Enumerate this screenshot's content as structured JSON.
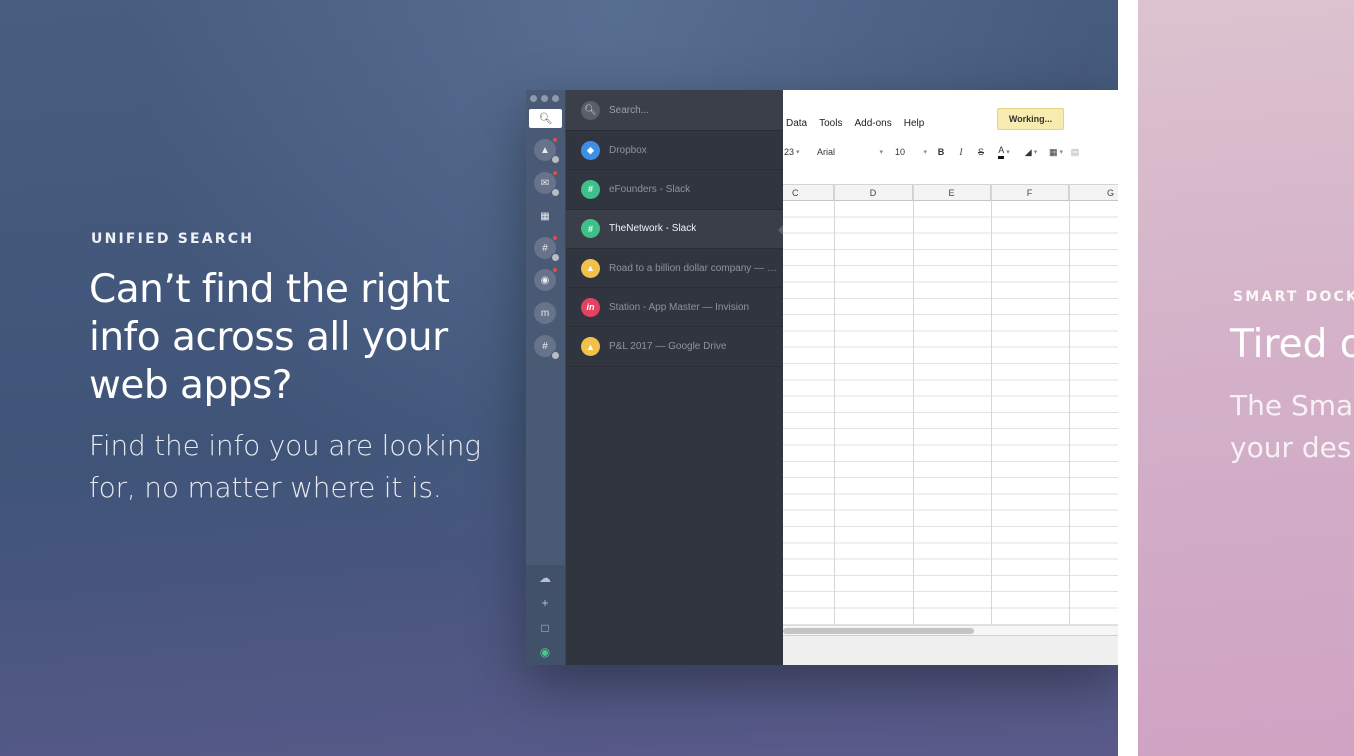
{
  "slide": {
    "eyebrow": "UNIFIED SEARCH",
    "headline": "Can’t find the right info across all your web apps?",
    "subline": "Find the info you are looking for, no matter where it is."
  },
  "search": {
    "placeholder": "Search..."
  },
  "results": [
    {
      "label": "Dropbox",
      "icon": "dropbox-icon",
      "color": "#3d8fe6"
    },
    {
      "label": "eFounders - Slack",
      "icon": "slack-icon",
      "color": "#3fbf8a"
    },
    {
      "label": "TheNetwork - Slack",
      "icon": "slack-icon",
      "color": "#3fbf8a"
    },
    {
      "label": "Road to a billion dollar company — G...",
      "icon": "google-drive-icon",
      "color": "#f2c14a"
    },
    {
      "label": "Station - App Master — Invision",
      "icon": "invision-icon",
      "color": "#e34363"
    },
    {
      "label": "P&L 2017 — Google Drive",
      "icon": "google-drive-icon",
      "color": "#f2c14a"
    }
  ],
  "spreadsheet": {
    "menu": [
      "Data",
      "Tools",
      "Add-ons",
      "Help"
    ],
    "status": "Working...",
    "zoom_fragment": "23",
    "font": "Arial",
    "font_size": "10",
    "bold": "B",
    "italic": "I",
    "strike": "S",
    "text_color": "A",
    "columns": [
      "C",
      "D",
      "E",
      "F",
      "G"
    ]
  },
  "next_slide": {
    "eyebrow": "SMART DOCK",
    "headline": "Tired o",
    "sub_line1": "The Smar",
    "sub_line2": "your desk"
  },
  "colors": {
    "dock_bg": "#4a5a74",
    "results_bg": "#31353f",
    "status_bg": "#f7ebb0",
    "next_slide_pink": "#d3b0c8"
  }
}
